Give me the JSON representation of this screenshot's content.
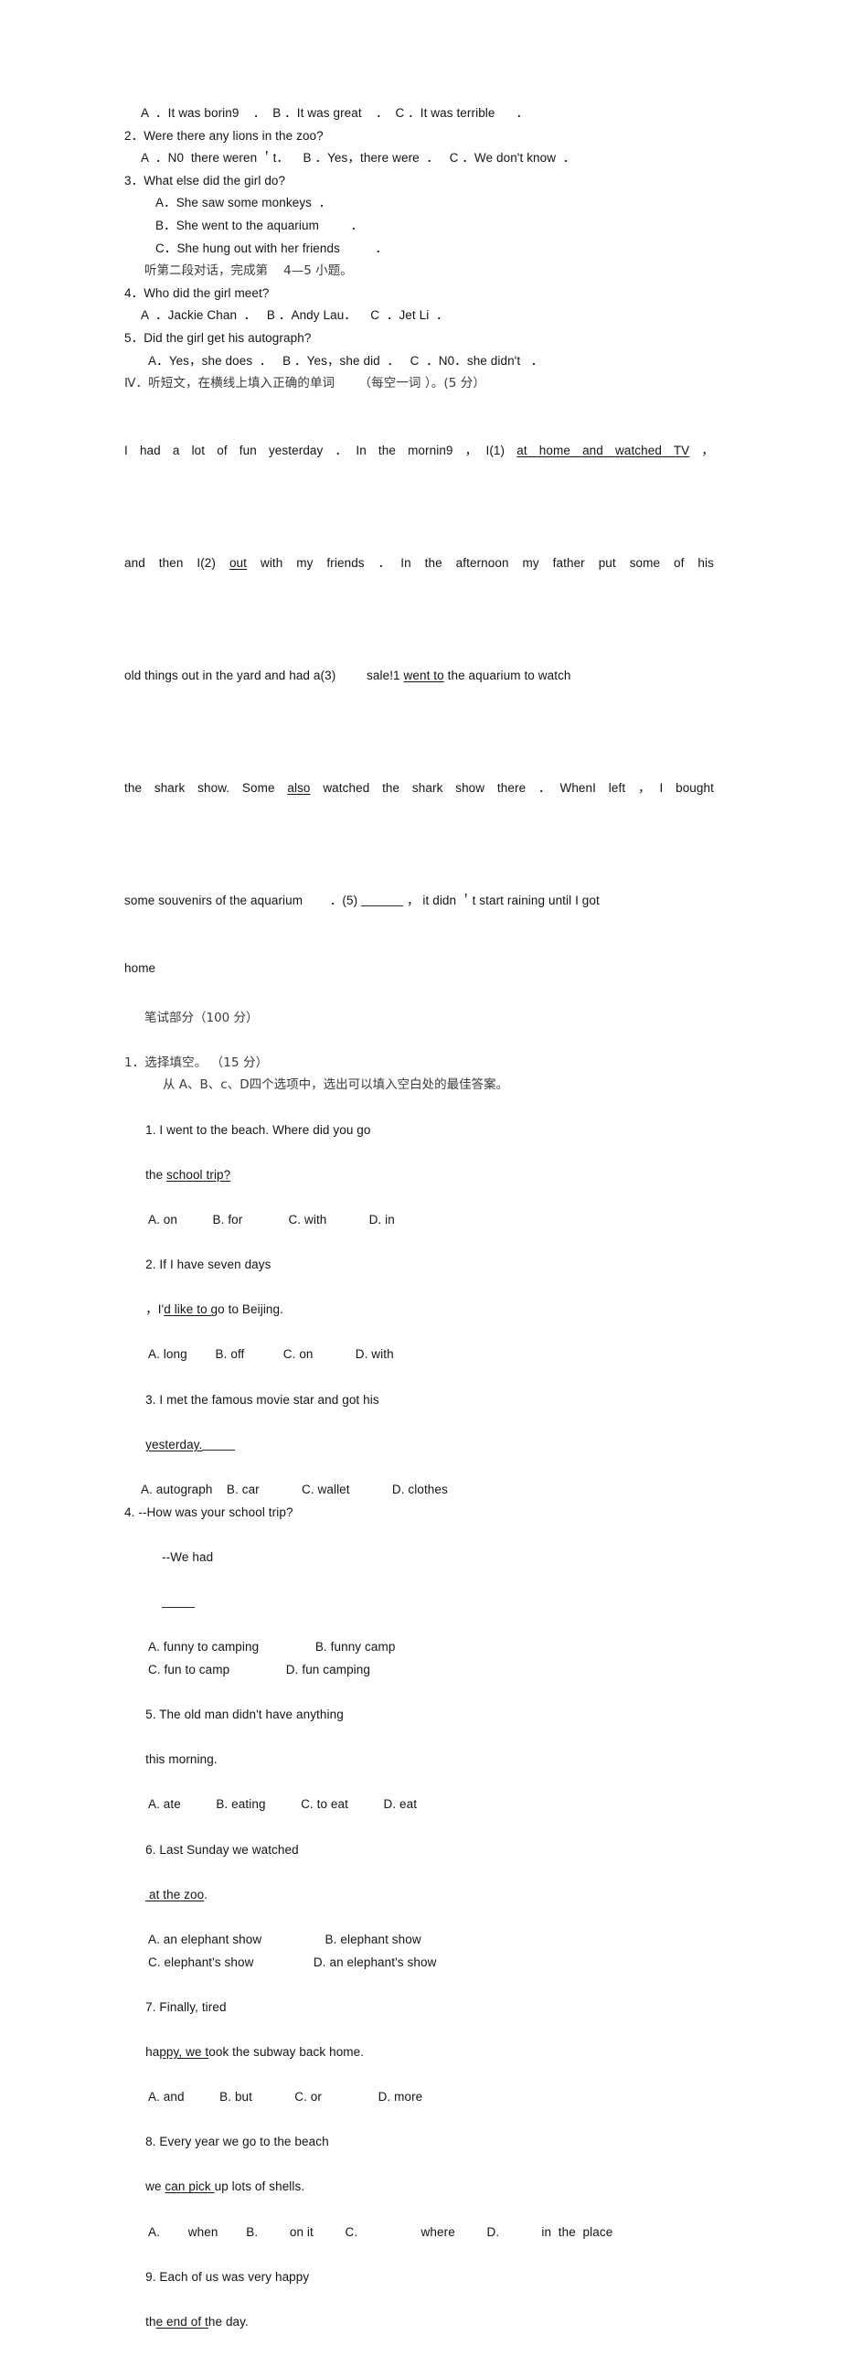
{
  "document": {
    "type": "scanned-exam-paper",
    "background": "#ffffff",
    "text_color": "#141414"
  },
  "listening": {
    "q1_options": "A  ．It was borin9    ．  B ．It was great    ．  C ．It was terrible      ．",
    "q2": {
      "stem": "2．Were there any lions in the zoo?",
      "options": "A  ．N0  there weren ＇t．    B ．Yes，there were  ．   C ．We don't know  ．"
    },
    "q3": {
      "stem": "3．What else did the girl do?",
      "optionA": "A．She saw some monkeys  ．",
      "optionB": "B．She went to the aquarium         ．",
      "optionC": "C．She hung out with her friends          ．"
    },
    "instruction_dialog2": "听第二段对话，完成第    4—5 小题。",
    "q4": {
      "stem": "4．Who did the girl meet?",
      "options": "A  ．Jackie Chan  ．   B ．Andy Lau．    C  ．Jet Li  ．"
    },
    "q5": {
      "stem": "5．Did the girl get his autograph?",
      "options": "A．Yes，she does  ．   B ．Yes，she did  ．   C  ．N0．she didn't   ．"
    }
  },
  "section4": {
    "heading": "Ⅳ．听短文，在横线上填入正确的单词      （每空一词 ）。(5 分）",
    "passage": {
      "line1_a": "I had a lot of fun yesterday",
      "line1_b": "．In the mornin9  ，I(1)",
      "line1_blank_text": "at home and watched TV",
      "line1_c": "，",
      "line2_a": "and then  I(2)",
      "line2_blank_text": "out",
      "line2_b": "with  my friends  ．In  the  afternoon  my father   put  some of  his",
      "line3_a": "old things out in the yard and had a(3)",
      "line3_b": "sale!1",
      "line3_blank_text": "went to",
      "line3_c": "the aquarium to watch",
      "line4_a": "the  shark  show. Some",
      "line4_blank_text": "also",
      "line4_b": "watched  the  shark  show there  ．WhenI  left  ，I  bought",
      "line5_a": "some souvenirs of the aquarium",
      "line5_b": "．(5)",
      "line5_c": "，  it didn  ＇t start raining until I got",
      "line6": "home"
    }
  },
  "written_part": {
    "heading": "笔试部分（100 分）"
  },
  "section1": {
    "heading": "1．选择填空。 （15 分）",
    "instruction": "从 A、B、c、D四个选项中，选出可以填入空白处的最佳答案。",
    "questions": [
      {
        "stem_a": "1. I went to the beach. Where did you go",
        "stem_b": "the ",
        "stem_u": "school trip?",
        "options": "A. on          B. for             C. with            D. in"
      },
      {
        "stem_a": "2. If I have seven days",
        "stem_b": "，I'",
        "stem_u": "d like to g",
        "stem_c": "o to Beijing.",
        "options": "A. long        B. off           C. on            D. with"
      },
      {
        "stem_a": "3. I met the famous movie star and got his",
        "stem_u": "yesterday.",
        "stem_blank": true,
        "options": "A. autograph    B. car            C. wallet            D. clothes"
      },
      {
        "stem_a": "4. --How was your school trip?",
        "stem_b": "--We had",
        "optionsA": "A. funny to camping                B. funny camp",
        "optionsB": "C. fun to camp                D. fun camping"
      },
      {
        "stem_a": "5. The old man didn't have anything",
        "stem_b": "this morning.",
        "options": "A. ate          B. eating          C. to eat          D. eat"
      },
      {
        "stem_a": "6. Last Sunday we watched",
        "stem_u": " at the zoo",
        "stem_b": ".",
        "optionsA": "A. an elephant show                  B. elephant show",
        "optionsB": "C. elephant's show                 D. an elephant's show"
      },
      {
        "stem_a": "7. Finally, tired",
        "stem_b": "ha",
        "stem_u": "ppy, we t",
        "stem_c": "ook the subway back home.",
        "options": "A. and          B. but            C. or                D. more"
      },
      {
        "stem_a": "8. Every year we go to the beach",
        "stem_b": "we ",
        "stem_u": "can pick ",
        "stem_c": "up lots of shells.",
        "options": "A.        when        B.         on it         C.                  where         D.            in  the  place"
      },
      {
        "stem_a": "9. Each of us was very happy",
        "stem_b": "th",
        "stem_u": "e end of t",
        "stem_c": "he day."
      }
    ]
  }
}
